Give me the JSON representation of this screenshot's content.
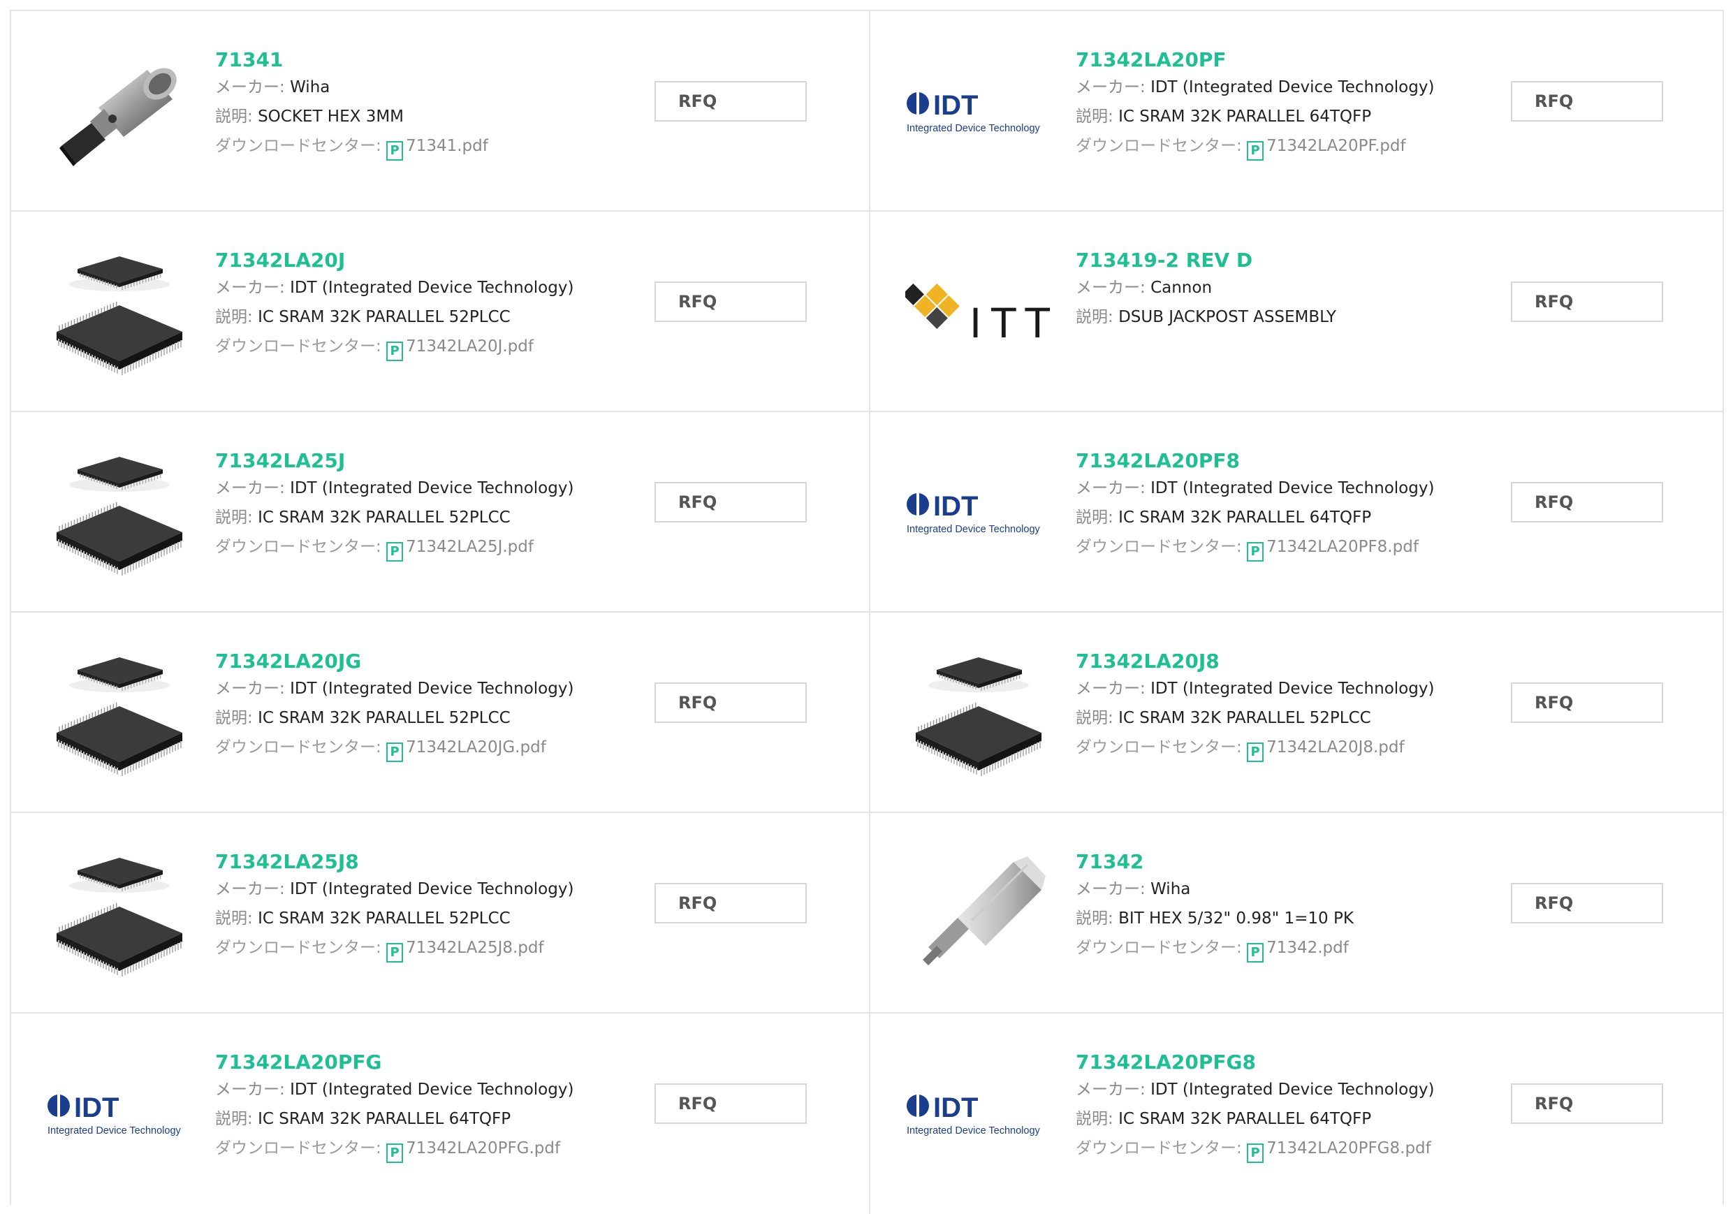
{
  "labels": {
    "maker": "メーカー: ",
    "description": "説明: ",
    "download": "ダウンロードセンター: ",
    "pdf_icon": "P"
  },
  "items": [
    {
      "name": "71341",
      "maker": "Wiha",
      "description": "SOCKET HEX 3MM",
      "pdf": "71341.pdf",
      "image": "hex-socket-image",
      "rfq": "RFQ"
    },
    {
      "name": "71342LA20PF",
      "maker": "IDT (Integrated Device Technology)",
      "description": "IC SRAM 32K PARALLEL 64TQFP",
      "pdf": "71342LA20PF.pdf",
      "image": "idt-logo",
      "rfq": "RFQ"
    },
    {
      "name": "71342LA20J",
      "maker": "IDT (Integrated Device Technology)",
      "description": "IC SRAM 32K PARALLEL 52PLCC",
      "pdf": "71342LA20J.pdf",
      "image": "plcc-chip-image",
      "rfq": "RFQ"
    },
    {
      "name": "713419-2 REV D",
      "maker": "Cannon",
      "description": "DSUB JACKPOST ASSEMBLY",
      "pdf": "",
      "image": "itt-logo",
      "rfq": "RFQ"
    },
    {
      "name": "71342LA25J",
      "maker": "IDT (Integrated Device Technology)",
      "description": "IC SRAM 32K PARALLEL 52PLCC",
      "pdf": "71342LA25J.pdf",
      "image": "plcc-chip-image",
      "rfq": "RFQ"
    },
    {
      "name": "71342LA20PF8",
      "maker": "IDT (Integrated Device Technology)",
      "description": "IC SRAM 32K PARALLEL 64TQFP",
      "pdf": "71342LA20PF8.pdf",
      "image": "idt-logo",
      "rfq": "RFQ"
    },
    {
      "name": "71342LA20JG",
      "maker": "IDT (Integrated Device Technology)",
      "description": "IC SRAM 32K PARALLEL 52PLCC",
      "pdf": "71342LA20JG.pdf",
      "image": "plcc-chip-image",
      "rfq": "RFQ"
    },
    {
      "name": "71342LA20J8",
      "maker": "IDT (Integrated Device Technology)",
      "description": "IC SRAM 32K PARALLEL 52PLCC",
      "pdf": "71342LA20J8.pdf",
      "image": "plcc-chip-image",
      "rfq": "RFQ"
    },
    {
      "name": "71342LA25J8",
      "maker": "IDT (Integrated Device Technology)",
      "description": "IC SRAM 32K PARALLEL 52PLCC",
      "pdf": "71342LA25J8.pdf",
      "image": "plcc-chip-image",
      "rfq": "RFQ"
    },
    {
      "name": "71342",
      "maker": "Wiha",
      "description": "BIT HEX 5/32\" 0.98\" 1=10 PK",
      "pdf": "71342.pdf",
      "image": "hex-bit-image",
      "rfq": "RFQ"
    },
    {
      "name": "71342LA20PFG",
      "maker": "IDT (Integrated Device Technology)",
      "description": "IC SRAM 32K PARALLEL 64TQFP",
      "pdf": "71342LA20PFG.pdf",
      "image": "idt-logo",
      "rfq": "RFQ"
    },
    {
      "name": "71342LA20PFG8",
      "maker": "IDT (Integrated Device Technology)",
      "description": "IC SRAM 32K PARALLEL 64TQFP",
      "pdf": "71342LA20PFG8.pdf",
      "image": "idt-logo",
      "rfq": "RFQ"
    }
  ],
  "logos": {
    "idt_mark": "IDT",
    "idt_tagline": "Integrated Device Technology",
    "itt_text": "ITT"
  },
  "colors": {
    "accent": "#1fbf93",
    "border": "#e4e4e4",
    "idt_blue": "#1a3e8c",
    "itt_gold": "#f0b323"
  }
}
